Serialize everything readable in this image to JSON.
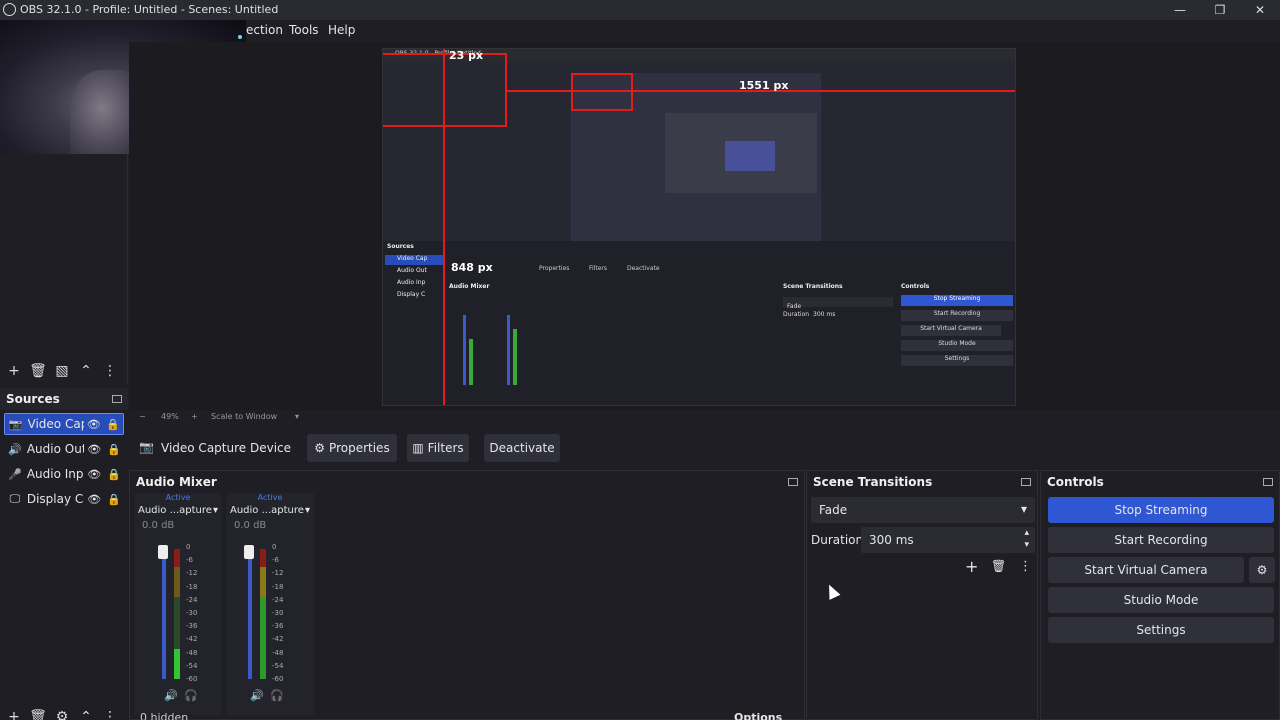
{
  "window": {
    "title": "OBS 32.1.0 - Profile: Untitled - Scenes: Untitled",
    "minimize": "—",
    "restore": "❐",
    "close": "✕"
  },
  "menu": {
    "items": [
      "ection",
      "Tools",
      "Help"
    ]
  },
  "preview": {
    "measure_top": "23 px",
    "measure_right": "1551 px",
    "measure_left": "848 px",
    "zoom": "49%",
    "scale_mode": "Scale to Window",
    "nested": {
      "title": "OBS 32.1.0 - Profile: Untitled",
      "sources_label": "Sources",
      "source_items": [
        "Video Cap",
        "Audio Out",
        "Audio Inp",
        "Display C"
      ],
      "mixer_label": "Audio Mixer",
      "transitions_label": "Scene Transitions",
      "controls_label": "Controls",
      "buttons": [
        "Stop Streaming",
        "Start Recording",
        "Start Virtual Camera",
        "Studio Mode",
        "Settings"
      ],
      "fade": "Fade",
      "duration": "Duration",
      "duration_val": "300 ms",
      "ctx_buttons": [
        "Properties",
        "Filters",
        "Deactivate"
      ]
    }
  },
  "sources": {
    "title": "Sources",
    "items": [
      {
        "icon": "camera-icon",
        "name": "Video Cap",
        "selected": true
      },
      {
        "icon": "speaker-icon",
        "name": "Audio Out",
        "selected": false
      },
      {
        "icon": "microphone-icon",
        "name": "Audio Inp",
        "selected": false
      },
      {
        "icon": "monitor-icon",
        "name": "Display Ca",
        "selected": false
      }
    ]
  },
  "context": {
    "source_name": "Video Capture Device",
    "properties": "Properties",
    "filters": "Filters",
    "deactivate": "Deactivate"
  },
  "mixer": {
    "title": "Audio Mixer",
    "channels": [
      {
        "status": "Active",
        "name": "Audio ...apture",
        "db": "0.0 dB"
      },
      {
        "status": "Active",
        "name": "Audio ...apture",
        "db": "0.0 dB"
      }
    ],
    "scale": [
      "0",
      "-6",
      "-12",
      "-18",
      "-24",
      "-30",
      "-36",
      "-42",
      "-48",
      "-54",
      "-60"
    ],
    "hidden": "0 hidden",
    "options": "Options"
  },
  "transitions": {
    "title": "Scene Transitions",
    "selected": "Fade",
    "duration_label": "Duration",
    "duration_value": "300 ms"
  },
  "controls": {
    "title": "Controls",
    "stop_streaming": "Stop Streaming",
    "start_recording": "Start Recording",
    "start_virtual_camera": "Start Virtual Camera",
    "studio_mode": "Studio Mode",
    "settings": "Settings"
  },
  "colors": {
    "accent": "#2f56d3",
    "selection": "#284cb8",
    "measure": "#e51b1b"
  }
}
